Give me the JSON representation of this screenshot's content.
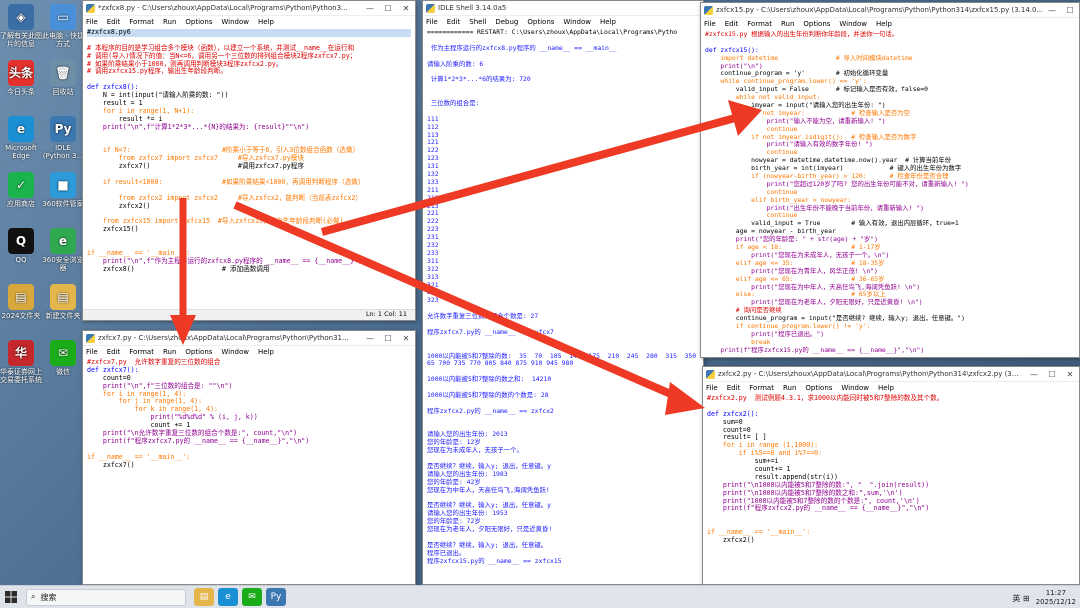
{
  "desktop": {
    "icons": [
      {
        "label": "了解有关此图片的信息",
        "glyph": "◈",
        "color": "#3a6ea5"
      },
      {
        "label": "此电脑 - 快捷方式",
        "glyph": "▭",
        "color": "#4a90d9"
      },
      {
        "label": "今日头条",
        "glyph": "头条",
        "color": "#e5312c"
      },
      {
        "label": "回收站",
        "glyph": "🗑",
        "color": "#6f8fa8"
      },
      {
        "label": "Microsoft Edge",
        "glyph": "e",
        "color": "#1b8fd4"
      },
      {
        "label": "IDLE (Python 3...",
        "glyph": "Py",
        "color": "#3b77b0"
      },
      {
        "label": "应用商店",
        "glyph": "✓",
        "color": "#1bb34c"
      },
      {
        "label": "360软件管家",
        "glyph": "■",
        "color": "#2d9bd9"
      },
      {
        "label": "QQ",
        "glyph": "Q",
        "color": "#111111"
      },
      {
        "label": "360安全浏览器",
        "glyph": "e",
        "color": "#2fa84f"
      },
      {
        "label": "2024文件夹",
        "glyph": "▤",
        "color": "#d9a83c"
      },
      {
        "label": "新建文件夹",
        "glyph": "▤",
        "color": "#e3b54a"
      },
      {
        "label": "华泰证券网上交易委托系统",
        "glyph": "华",
        "color": "#c4282a"
      },
      {
        "label": "微信",
        "glyph": "✉",
        "color": "#1aad19"
      }
    ]
  },
  "windows": {
    "editor1": {
      "title": "*zxfcx8.py - C:\\Users\\zhoux\\AppData\\Local\\Programs\\Python\\Python3...",
      "menu": [
        "File",
        "Edit",
        "Format",
        "Run",
        "Options",
        "Window",
        "Help"
      ],
      "status": "Ln: 1    Col: 11",
      "lines": [
        {
          "t": "#zxfcx8.py6",
          "c": "t-highlight"
        },
        {
          "t": "",
          "c": "t-default"
        },
        {
          "t": "# 本程序的目的是学习组合多个模块（函数），以建立一个系统，并测试__name__在运行和",
          "c": "t-comment"
        },
        {
          "t": "# 调用(导入)情况下的值：当N<=6，调用另一个三位数的排列组合模块2程序zxfcx7.py；",
          "c": "t-comment"
        },
        {
          "t": "# 如果阶乘结果小于1000，则再调用判断模块3程序zxfcx2.py。",
          "c": "t-comment"
        },
        {
          "t": "# 调用zxfcx15.py程序，输出生年龄段判断。",
          "c": "t-comment"
        },
        {
          "t": "",
          "c": "t-default"
        },
        {
          "t": "def zxfcx8():",
          "c": "t-def"
        },
        {
          "t": "    N = int(input(\"请输入阶乘的数: \"))",
          "c": "t-default"
        },
        {
          "t": "    result = 1",
          "c": "t-default"
        },
        {
          "t": "    for i in range(1, N+1):",
          "c": "t-keyword"
        },
        {
          "t": "        result *= i",
          "c": "t-default"
        },
        {
          "t": "    print(\"\\n\",f\"计算1*2*3*...*{N}的结果为: {result}\"\"\\n\")",
          "c": "t-builtin"
        },
        {
          "t": "",
          "c": "t-default"
        },
        {
          "t": "",
          "c": "t-default"
        },
        {
          "t": "    if N<7:                       #阶乘小于等于6，引入3位数组合函数（选做）",
          "c": "t-keyword"
        },
        {
          "t": "        from zxfcx7 import zxfcx7     #导入zxfcx7.py模块",
          "c": "t-keyword"
        },
        {
          "t": "        zxfcx7()                      #调用zxfcx7.py程序",
          "c": "t-default"
        },
        {
          "t": "",
          "c": "t-default"
        },
        {
          "t": "    if result<1000:               #如果阶乘结果<1000，再调用判断程序（选做）",
          "c": "t-keyword"
        },
        {
          "t": "",
          "c": "t-default"
        },
        {
          "t": "        from zxfcx2 import zxfcx2     #导入zxfcx2，能判断（当前表zxfcx2）",
          "c": "t-keyword"
        },
        {
          "t": "        zxfcx2()",
          "c": "t-default"
        },
        {
          "t": "",
          "c": "t-default"
        },
        {
          "t": "    from zxfcx15 import zxfcx15  #导入zxfcx15，能出生年龄段判断(必做)",
          "c": "t-keyword"
        },
        {
          "t": "    zxfcx15()",
          "c": "t-default"
        },
        {
          "t": "",
          "c": "t-default"
        },
        {
          "t": "",
          "c": "t-default"
        },
        {
          "t": "if __name__ == '__main__':",
          "c": "t-keyword"
        },
        {
          "t": "    print(\"\\n\",f\"作为主程序运行的zxfcx8.py程序的 __name__ == {__name__}\")",
          "c": "t-builtin"
        },
        {
          "t": "    zxfcx8()                      # 添加函数调用",
          "c": "t-default"
        }
      ]
    },
    "editor2": {
      "title": "zxfcx7.py - C:\\Users\\zhoux\\AppData\\Local\\Programs\\Python\\Python31...",
      "menu": [
        "File",
        "Edit",
        "Format",
        "Run",
        "Options",
        "Window",
        "Help"
      ],
      "lines": [
        {
          "t": "#zxfcx7.py  允许数字重复的三位数的组合",
          "c": "t-comment"
        },
        {
          "t": "def zxfcx7():",
          "c": "t-def"
        },
        {
          "t": "    count=0",
          "c": "t-default"
        },
        {
          "t": "    print(\"\\n\",f\"三位数的组合是: \"\"\\n\")",
          "c": "t-builtin"
        },
        {
          "t": "    for i in range(1, 4):",
          "c": "t-keyword"
        },
        {
          "t": "        for j in range(1, 4):",
          "c": "t-keyword"
        },
        {
          "t": "            for k in range(1, 4):",
          "c": "t-keyword"
        },
        {
          "t": "                print(\"%d%d%d\" % (i, j, k))",
          "c": "t-builtin"
        },
        {
          "t": "                count += 1",
          "c": "t-default"
        },
        {
          "t": "    print(\"\\n允许数字重复三位数的组合个数是:\", count,\"\\n\")",
          "c": "t-builtin"
        },
        {
          "t": "    print(f\"程序zxfcx7.py的 __name__ == {__name__}\",\"\\n\")",
          "c": "t-builtin"
        },
        {
          "t": "",
          "c": "t-default"
        },
        {
          "t": "if __name__ == '__main__':",
          "c": "t-keyword"
        },
        {
          "t": "    zxfcx7()",
          "c": "t-default"
        }
      ]
    },
    "shell": {
      "title": "IDLE Shell 3.14.0a5",
      "menu": [
        "File",
        "Edit",
        "Shell",
        "Debug",
        "Options",
        "Window",
        "Help"
      ],
      "lines": [
        {
          "t": "============ RESTART: C:\\Users\\zhoux\\AppData\\Local\\Programs\\Pytho",
          "c": "t-default"
        },
        {
          "t": "",
          "c": "t-default"
        },
        {
          "t": " 作为主程序运行的zxfcx8.py程序的 __name__ == __main__",
          "c": "t-stdout"
        },
        {
          "t": "",
          "c": "t-default"
        },
        {
          "t": "请输入阶乘的数: 6",
          "c": "t-stdout"
        },
        {
          "t": "",
          "c": "t-default"
        },
        {
          "t": " 计算1*2*3*...*6的结果为: 720",
          "c": "t-stdout"
        },
        {
          "t": "",
          "c": "t-default"
        },
        {
          "t": "",
          "c": "t-default"
        },
        {
          "t": " 三位数的组合是:",
          "c": "t-stdout"
        },
        {
          "t": "",
          "c": "t-default"
        },
        {
          "t": "111",
          "c": "t-stdout"
        },
        {
          "t": "112",
          "c": "t-stdout"
        },
        {
          "t": "113",
          "c": "t-stdout"
        },
        {
          "t": "121",
          "c": "t-stdout"
        },
        {
          "t": "122",
          "c": "t-stdout"
        },
        {
          "t": "123",
          "c": "t-stdout"
        },
        {
          "t": "131",
          "c": "t-stdout"
        },
        {
          "t": "132",
          "c": "t-stdout"
        },
        {
          "t": "133",
          "c": "t-stdout"
        },
        {
          "t": "211",
          "c": "t-stdout"
        },
        {
          "t": "212",
          "c": "t-stdout"
        },
        {
          "t": "213",
          "c": "t-stdout"
        },
        {
          "t": "221",
          "c": "t-stdout"
        },
        {
          "t": "222",
          "c": "t-stdout"
        },
        {
          "t": "223",
          "c": "t-stdout"
        },
        {
          "t": "231",
          "c": "t-stdout"
        },
        {
          "t": "232",
          "c": "t-stdout"
        },
        {
          "t": "233",
          "c": "t-stdout"
        },
        {
          "t": "311",
          "c": "t-stdout"
        },
        {
          "t": "312",
          "c": "t-stdout"
        },
        {
          "t": "313",
          "c": "t-stdout"
        },
        {
          "t": "321",
          "c": "t-stdout"
        },
        {
          "t": "322",
          "c": "t-stdout"
        },
        {
          "t": "323",
          "c": "t-stdout"
        },
        {
          "t": "",
          "c": "t-default"
        },
        {
          "t": "允许数字重复三位数的组合个数是: 27",
          "c": "t-stdout"
        },
        {
          "t": "",
          "c": "t-default"
        },
        {
          "t": "程序zxfcx7.py的 __name__ == zxfcx7",
          "c": "t-stdout"
        },
        {
          "t": "",
          "c": "t-default"
        },
        {
          "t": "",
          "c": "t-default"
        },
        {
          "t": "1000以内能被5和7整除的数:  35  70  105  140  175  210  245  280  315  350",
          "c": "t-stdout"
        },
        {
          "t": "65 700 735 770 805 840 875 910 945 980",
          "c": "t-stdout"
        },
        {
          "t": "",
          "c": "t-default"
        },
        {
          "t": "1000以内能被5和7整除的数之和:  14210",
          "c": "t-stdout"
        },
        {
          "t": "",
          "c": "t-default"
        },
        {
          "t": "1000以内能被5和7整除的数的个数是: 28",
          "c": "t-stdout"
        },
        {
          "t": "",
          "c": "t-default"
        },
        {
          "t": "程序zxfcx2.py的 __name__ == zxfcx2",
          "c": "t-stdout"
        },
        {
          "t": "",
          "c": "t-default"
        },
        {
          "t": "",
          "c": "t-default"
        },
        {
          "t": "请输入您的出生年份: 2013",
          "c": "t-stdout"
        },
        {
          "t": "您的年龄是: 12岁",
          "c": "t-stdout"
        },
        {
          "t": "您现在为未成年人，无孩子一个。",
          "c": "t-stdout"
        },
        {
          "t": "",
          "c": "t-default"
        },
        {
          "t": "是否继续？继续，输入y; 退出，任意键。y",
          "c": "t-stdout"
        },
        {
          "t": "请输入您的出生年份: 1983",
          "c": "t-stdout"
        },
        {
          "t": "您的年龄是: 42岁",
          "c": "t-stdout"
        },
        {
          "t": "您现在为中年人，天高任鸟飞,海阔凭鱼跃!",
          "c": "t-stdout"
        },
        {
          "t": "",
          "c": "t-default"
        },
        {
          "t": "是否继续？继续，输入y; 退出，任意键。y",
          "c": "t-stdout"
        },
        {
          "t": "请输入您的出生年份: 1953",
          "c": "t-stdout"
        },
        {
          "t": "您的年龄是: 72岁",
          "c": "t-stdout"
        },
        {
          "t": "您现在为老年人，夕阳无限好，只是近黄昏!",
          "c": "t-stdout"
        },
        {
          "t": "",
          "c": "t-default"
        },
        {
          "t": "是否继续？继续，输入y; 退出，任意键。",
          "c": "t-stdout"
        },
        {
          "t": "程序已退出。",
          "c": "t-stdout"
        },
        {
          "t": "程序zxfcx15.py的 __name__ == zxfcx15",
          "c": "t-stdout"
        }
      ]
    },
    "editor3": {
      "title": "zxfcx15.py - C:\\Users\\zhoux\\AppData\\Local\\Programs\\Python\\Python314\\zxfcx15.py (3.14.0...",
      "menu": [
        "File",
        "Edit",
        "Format",
        "Run",
        "Options",
        "Window",
        "Help"
      ],
      "lines": [
        {
          "t": "#zxfcx15.py 根据输入的出生年份判断你年龄段，并送你一句话。",
          "c": "t-comment"
        },
        {
          "t": "",
          "c": "t-default"
        },
        {
          "t": "def zxfcx15():",
          "c": "t-def"
        },
        {
          "t": "    import datetime               # 导入时间模块datetime",
          "c": "t-keyword"
        },
        {
          "t": "    print(\"\\n\")",
          "c": "t-builtin"
        },
        {
          "t": "    continue_program = 'y'        # 初始化循环变量",
          "c": "t-default"
        },
        {
          "t": "    while continue_program.lower() == 'y':",
          "c": "t-keyword"
        },
        {
          "t": "        valid_input = False       # 标记输入是否有效，false=0",
          "c": "t-default"
        },
        {
          "t": "        while not valid_input:",
          "c": "t-keyword"
        },
        {
          "t": "            imyear = input(\"请输入您的出生年份: \")",
          "c": "t-default"
        },
        {
          "t": "            if not imyear:            # 检查输入是否为空",
          "c": "t-keyword"
        },
        {
          "t": "                print(\"输入不能为空，请重新输入! \")",
          "c": "t-builtin"
        },
        {
          "t": "                continue",
          "c": "t-keyword"
        },
        {
          "t": "            if not imyear.isdigit():  # 检查输入是否为数字",
          "c": "t-keyword"
        },
        {
          "t": "                print(\"请输入有效的数字年份! \")",
          "c": "t-builtin"
        },
        {
          "t": "                continue",
          "c": "t-keyword"
        },
        {
          "t": "            nowyear = datetime.datetime.now().year  # 计算当前年份",
          "c": "t-default"
        },
        {
          "t": "            birth_year = int(imyear)            # 键入的出生年份为数字",
          "c": "t-default"
        },
        {
          "t": "            if (nowyear-birth_year) > 120:      # 检查年份是否合理",
          "c": "t-keyword"
        },
        {
          "t": "                print(\"您超过120岁了吗? 您的出生年份可能不对，请重新输入! \")",
          "c": "t-builtin"
        },
        {
          "t": "                continue",
          "c": "t-keyword"
        },
        {
          "t": "            elif birth_year > nowyear:",
          "c": "t-keyword"
        },
        {
          "t": "                print(\"出生年份不能晚于当前年份，请重新输入! \")",
          "c": "t-builtin"
        },
        {
          "t": "                continue",
          "c": "t-keyword"
        },
        {
          "t": "            valid_input = True        # 输入有效，退出内层循环，true=1",
          "c": "t-default"
        },
        {
          "t": "        age = nowyear - birth_year",
          "c": "t-default"
        },
        {
          "t": "        print(\"您的年龄是: \" + str(age) + \"岁\")",
          "c": "t-builtin"
        },
        {
          "t": "        if age < 18:                  # 1-17岁",
          "c": "t-keyword"
        },
        {
          "t": "            print(\"您现在为未成年人，无孩子一个。\\n\")",
          "c": "t-builtin"
        },
        {
          "t": "        elif age <= 35:               # 18-35岁",
          "c": "t-keyword"
        },
        {
          "t": "            print(\"您现在为青年人，风华正茂! \\n\")",
          "c": "t-builtin"
        },
        {
          "t": "        elif age <= 65:               # 36-65岁",
          "c": "t-keyword"
        },
        {
          "t": "            print(\"您现在为中年人，天高任鸟飞,海阔凭鱼跃! \\n\")",
          "c": "t-builtin"
        },
        {
          "t": "        else:                         # 65岁以上",
          "c": "t-keyword"
        },
        {
          "t": "            print(\"您现在为老年人，夕阳无限好，只是近黄昏! \\n\")",
          "c": "t-builtin"
        },
        {
          "t": "        # 询问是否继续",
          "c": "t-comment"
        },
        {
          "t": "        continue_program = input(\"是否继续? 继续，输入y; 退出，任意键。\")",
          "c": "t-default"
        },
        {
          "t": "        if continue_program.lower() != 'y':",
          "c": "t-keyword"
        },
        {
          "t": "            print(\"程序已退出。\")",
          "c": "t-builtin"
        },
        {
          "t": "            break",
          "c": "t-keyword"
        },
        {
          "t": "    print(f\"程序zxfcx15.py的 __name__ == {__name__}\",\"\\n\")",
          "c": "t-builtin"
        },
        {
          "t": "",
          "c": "t-default"
        },
        {
          "t": "if __name__ == '__main__':",
          "c": "t-keyword"
        },
        {
          "t": "    zxfcx15()",
          "c": "t-default"
        }
      ]
    },
    "editor4": {
      "title": "zxfcx2.py - C:\\Users\\zhoux\\AppData\\Local\\Programs\\Python\\Python314\\zxfcx2.py (3...",
      "menu": [
        "File",
        "Edit",
        "Format",
        "Run",
        "Options",
        "Window",
        "Help"
      ],
      "lines": [
        {
          "t": "#zxfcx2.py  测试例题4.3.1，求1000以内能同时被5和7整除的数及其个数。",
          "c": "t-comment"
        },
        {
          "t": "",
          "c": "t-default"
        },
        {
          "t": "def zxfcx2():",
          "c": "t-def"
        },
        {
          "t": "    sum=0",
          "c": "t-default"
        },
        {
          "t": "    count=0",
          "c": "t-default"
        },
        {
          "t": "    result= [ ]",
          "c": "t-default"
        },
        {
          "t": "    for i in range (1,1000):",
          "c": "t-keyword"
        },
        {
          "t": "        if i%5==0 and i%7==0:",
          "c": "t-keyword"
        },
        {
          "t": "            sum+=i",
          "c": "t-default"
        },
        {
          "t": "            count+= 1",
          "c": "t-default"
        },
        {
          "t": "            result.append(str(i))",
          "c": "t-default"
        },
        {
          "t": "    print(\"\\n1000以内能被5和7整除的数:\", \"  \".join(result))",
          "c": "t-builtin"
        },
        {
          "t": "    print(\"\\n1000以内能被5和7整除的数之和:\",sum,'\\n')",
          "c": "t-builtin"
        },
        {
          "t": "    print(\"1000以内能被5和7整除的数的个数是:\", count,'\\n')",
          "c": "t-builtin"
        },
        {
          "t": "    print(f\"程序zxfcx2.py的 __name__ == {__name__}\",\"\\n\")",
          "c": "t-builtin"
        },
        {
          "t": "",
          "c": "t-default"
        },
        {
          "t": "",
          "c": "t-default"
        },
        {
          "t": "if __name__ == '__main__':",
          "c": "t-keyword"
        },
        {
          "t": "    zxfcx2()",
          "c": "t-default"
        }
      ]
    }
  },
  "taskbar": {
    "search_label": "搜索",
    "apps": [
      {
        "name": "file-explorer",
        "glyph": "▤",
        "color": "#e3b54a"
      },
      {
        "name": "edge",
        "glyph": "e",
        "color": "#1b8fd4"
      },
      {
        "name": "wechat",
        "glyph": "✉",
        "color": "#1aad19"
      },
      {
        "name": "idle-python",
        "glyph": "Py",
        "color": "#3b77b0"
      }
    ],
    "tray_text": "英 ⊞",
    "time": "11:27",
    "date": "2025/12/12"
  },
  "colors": {
    "arrow": "#ee3a24",
    "desktop": "#4d6f92"
  }
}
